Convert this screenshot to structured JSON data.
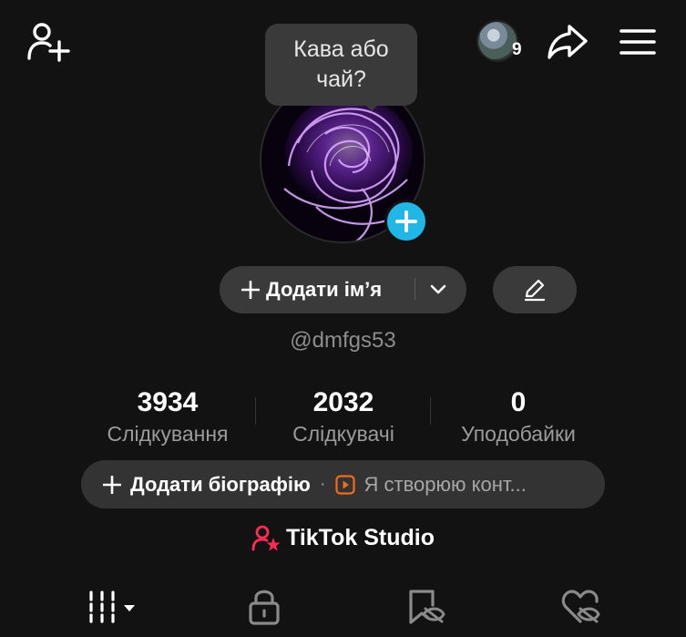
{
  "header": {
    "add_friend_icon": "person-add-icon",
    "notification_count": "9",
    "share_icon": "share-arrow-icon",
    "menu_icon": "hamburger-menu-icon"
  },
  "tooltip": {
    "text": "Кава або чай?"
  },
  "profile": {
    "add_name_label": "Додати ім’я",
    "username": "@dmfgs53"
  },
  "stats": [
    {
      "value": "3934",
      "label": "Слідкування"
    },
    {
      "value": "2032",
      "label": "Слідкувачі"
    },
    {
      "value": "0",
      "label": "Уподобайки"
    }
  ],
  "bio": {
    "add_label": "Додати біографію",
    "separator": "·",
    "creator_text": "Я створюю конт..."
  },
  "studio": {
    "label": "TikTok Studio"
  },
  "tabs": [
    "videos-grid-icon",
    "lock-icon",
    "reposts-icon",
    "liked-icon"
  ],
  "colors": {
    "background": "#121212",
    "pill": "#3a3a3a",
    "accent_blue": "#20b6e6",
    "studio_red": "#fe2c55",
    "creator_orange": "#f36a1f"
  }
}
